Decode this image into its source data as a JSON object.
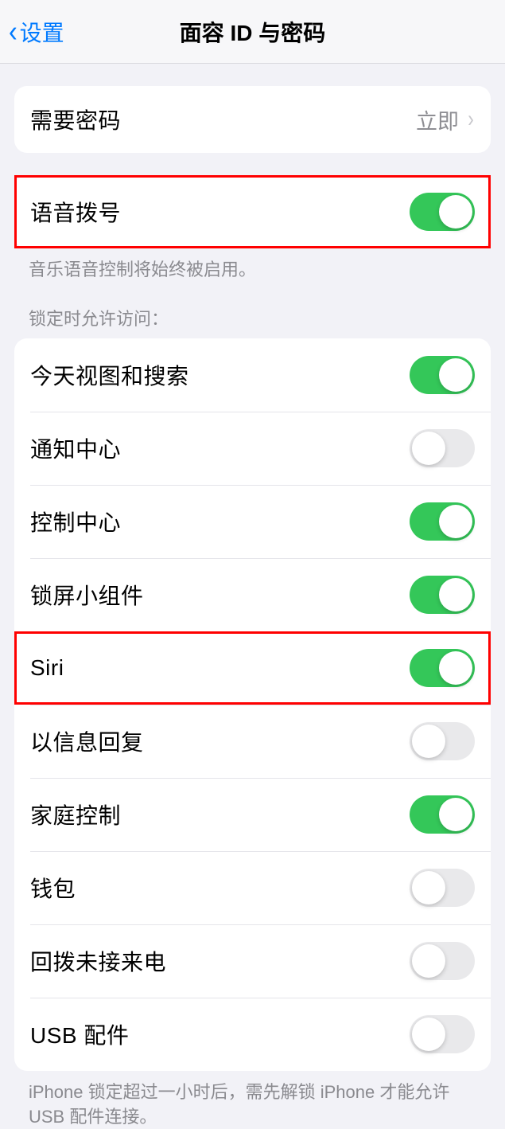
{
  "header": {
    "back_label": "设置",
    "title": "面容 ID 与密码"
  },
  "group1": {
    "row1_label": "需要密码",
    "row1_value": "立即"
  },
  "group2": {
    "row1_label": "语音拨号",
    "row1_on": true,
    "footer": "音乐语音控制将始终被启用。"
  },
  "section3_header": "锁定时允许访问：",
  "group3": {
    "items": [
      {
        "label": "今天视图和搜索",
        "on": true
      },
      {
        "label": "通知中心",
        "on": false
      },
      {
        "label": "控制中心",
        "on": true
      },
      {
        "label": "锁屏小组件",
        "on": true
      },
      {
        "label": "Siri",
        "on": true
      },
      {
        "label": "以信息回复",
        "on": false
      },
      {
        "label": "家庭控制",
        "on": true
      },
      {
        "label": "钱包",
        "on": false
      },
      {
        "label": "回拨未接来电",
        "on": false
      },
      {
        "label": "USB 配件",
        "on": false
      }
    ],
    "footer": "iPhone 锁定超过一小时后，需先解锁 iPhone 才能允许 USB 配件连接。"
  }
}
